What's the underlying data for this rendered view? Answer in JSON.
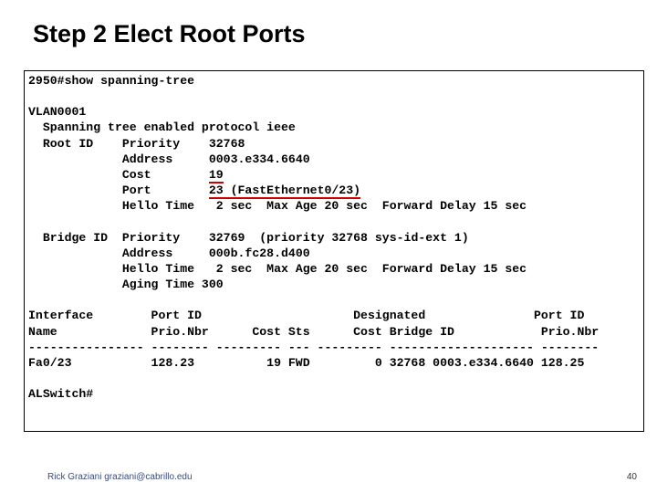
{
  "title": "Step 2   Elect Root Ports",
  "terminal": {
    "cmd": "2950#show spanning-tree",
    "vlan": "VLAN0001",
    "sp_line": "  Spanning tree enabled protocol ieee",
    "root_label": "  Root ID    ",
    "root_priority_lbl": "Priority    ",
    "root_priority_val": "32768",
    "root_address_lbl": "             Address     ",
    "root_address_val": "0003.e334.6640",
    "root_cost_lbl": "             Cost        ",
    "root_cost_val": "19",
    "root_port_lbl": "             Port        ",
    "root_port_val": "23 (FastEthernet0/23)",
    "root_hello_lbl": "             Hello Time   ",
    "root_hello_val": "2 sec  Max Age 20 sec  Forward Delay 15 sec",
    "bridge_label": "  Bridge ID  ",
    "bridge_pri_lbl": "Priority    ",
    "bridge_pri_val": "32769  (priority 32768 sys-id-ext 1)",
    "bridge_addr_lbl": "             Address     ",
    "bridge_addr_val": "000b.fc28.d400",
    "bridge_hello_lbl": "             Hello Time   ",
    "bridge_hello_val": "2 sec  Max Age 20 sec  Forward Delay 15 sec",
    "bridge_aging": "             Aging Time 300",
    "hdr1": "Interface        Port ID                     Designated               Port ID",
    "hdr2": "Name             Prio.Nbr      Cost Sts      Cost Bridge ID            Prio.Nbr",
    "dashes": "---------------- -------- --------- --- --------- -------------------- --------",
    "row": "Fa0/23           128.23          19 FWD         0 32768 0003.e334.6640 128.25",
    "end_prompt": "ALSwitch#"
  },
  "footer": {
    "left": "Rick Graziani  graziani@cabrillo.edu",
    "right": "40"
  }
}
